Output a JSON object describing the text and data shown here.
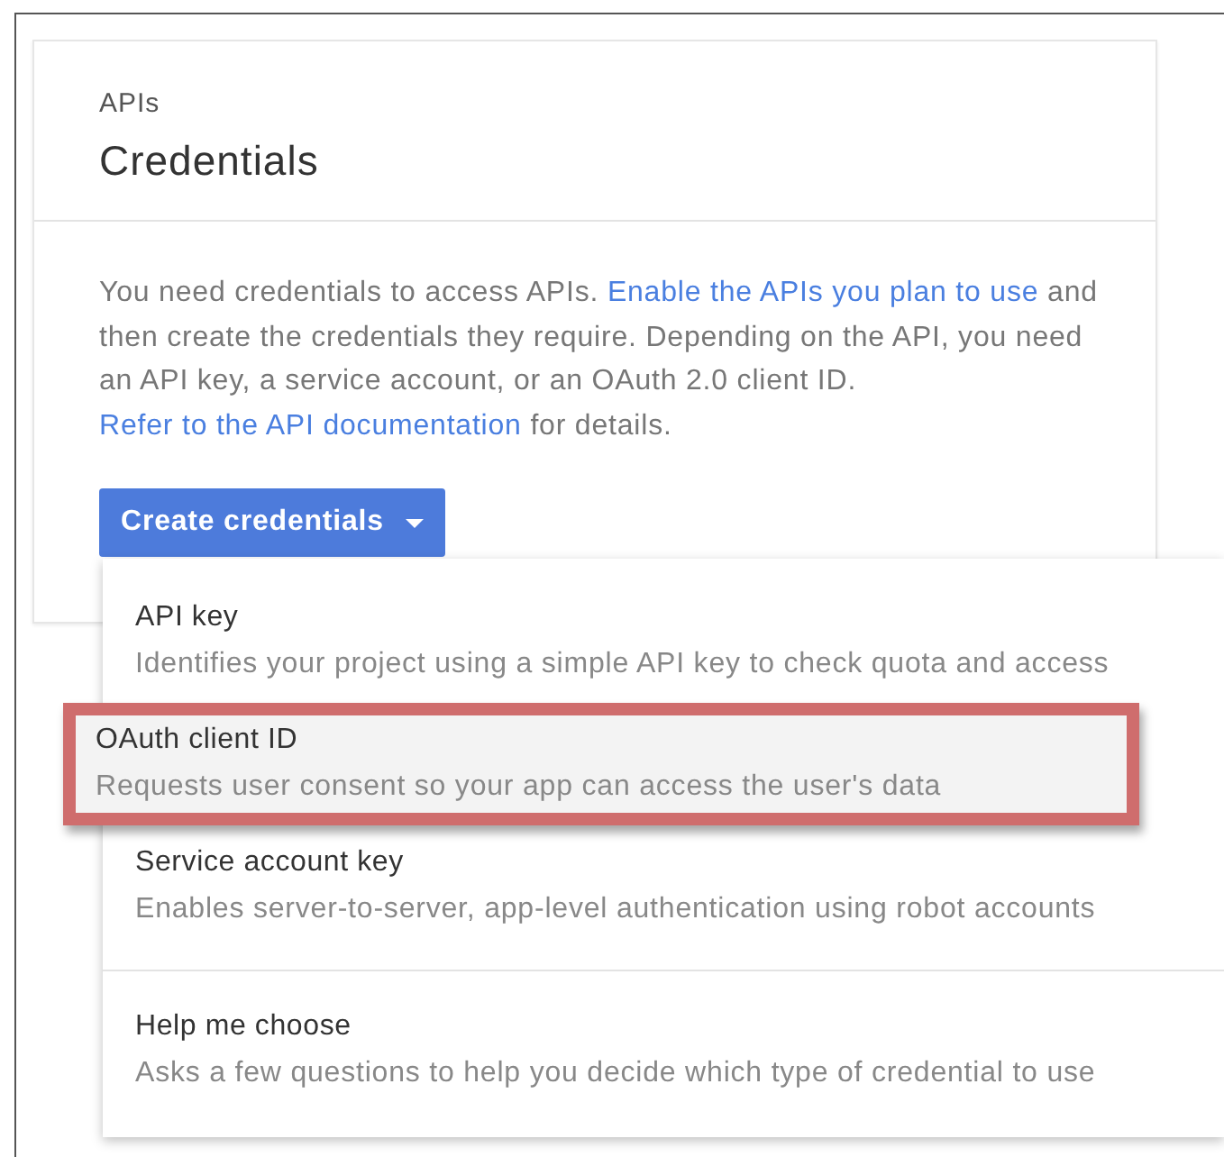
{
  "card": {
    "eyebrow": "APIs",
    "title": "Credentials",
    "paragraph": [
      {
        "text": "You need credentials to access APIs. ",
        "link": false
      },
      {
        "text": "Enable the APIs you plan to use",
        "link": true
      },
      {
        "text": " and then create the credentials they require. Depending on the API, you need an API key, a service account, or an OAuth 2.0 client ID. ",
        "link": false
      },
      {
        "text": "Refer to the API documentation",
        "link": true
      },
      {
        "text": " for details.",
        "link": false
      }
    ],
    "button": {
      "label": "Create credentials",
      "expanded": true
    }
  },
  "menu": {
    "items": [
      {
        "title": "API key",
        "description": "Identifies your project using a simple API key to check quota and access",
        "selected": false,
        "annotated": false,
        "divider_before": false
      },
      {
        "title": "OAuth client ID",
        "description": "Requests user consent so your app can access the user's data",
        "selected": true,
        "annotated": true,
        "divider_before": false
      },
      {
        "title": "Service account key",
        "description": "Enables server-to-server, app-level authentication using robot accounts",
        "selected": false,
        "annotated": false,
        "divider_before": false
      },
      {
        "title": "Help me choose",
        "description": "Asks a few questions to help you decide which type of credential to use",
        "selected": false,
        "annotated": false,
        "divider_before": true
      }
    ]
  }
}
